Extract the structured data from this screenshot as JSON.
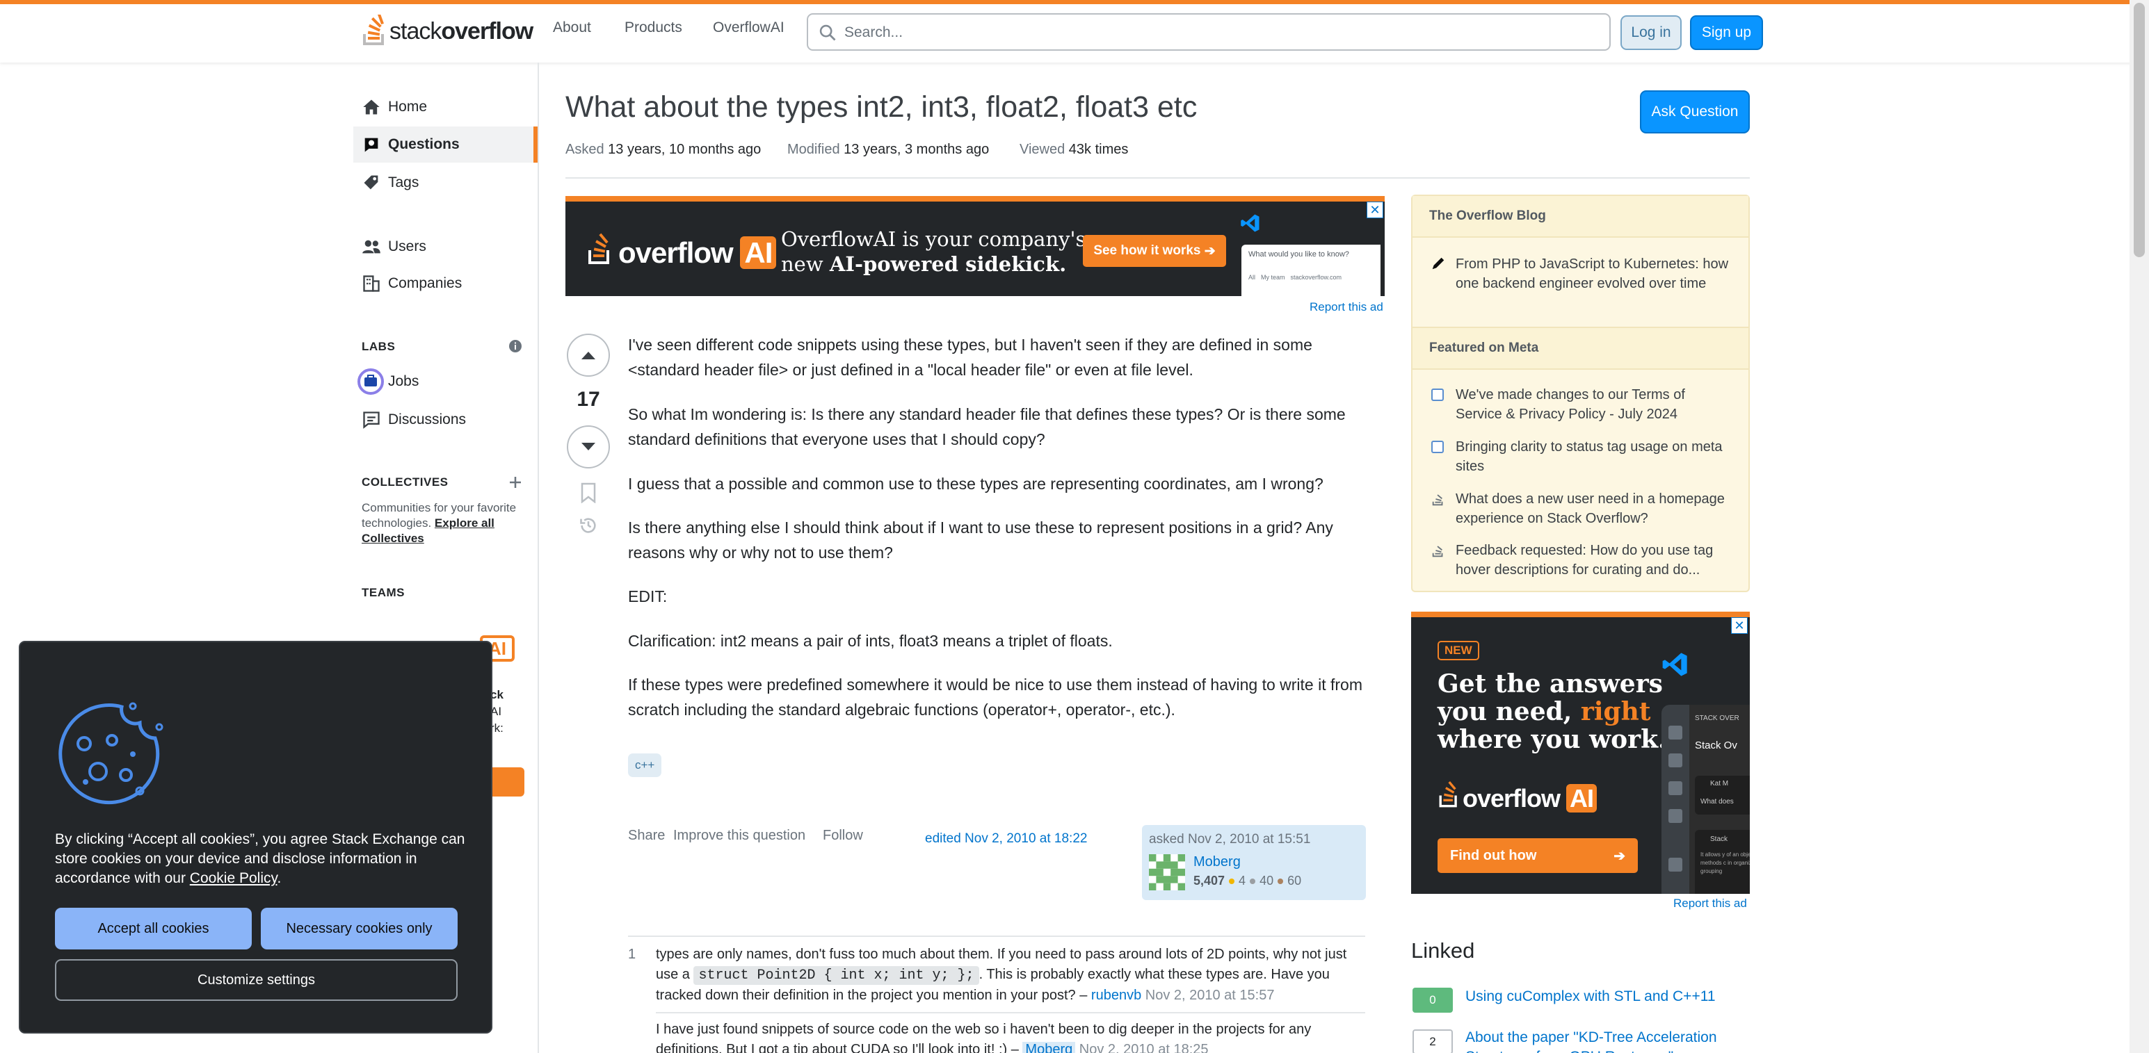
{
  "header": {
    "logo_text_a": "stack",
    "logo_text_b": "overflow",
    "nav": [
      "About",
      "Products",
      "OverflowAI"
    ],
    "search_placeholder": "Search...",
    "login": "Log in",
    "signup": "Sign up"
  },
  "sidebar": {
    "home": "Home",
    "questions": "Questions",
    "tags": "Tags",
    "users": "Users",
    "companies": "Companies",
    "labs_title": "LABS",
    "jobs": "Jobs",
    "discussions": "Discussions",
    "collectives_title": "COLLECTIVES",
    "collectives_text": "Communities for your favorite technologies.",
    "collectives_link": "Explore all Collectives",
    "teams_title": "TEAMS",
    "teams_partial": [
      "ck",
      "AI",
      "rk:"
    ]
  },
  "question": {
    "title": "What about the types int2, int3, float2, float3 etc",
    "asked_label": "Asked",
    "asked_value": "13 years, 10 months ago",
    "modified_label": "Modified",
    "modified_value": "13 years, 3 months ago",
    "viewed_label": "Viewed",
    "viewed_value": "43k times",
    "ask_button": "Ask Question",
    "votes": "17",
    "paragraphs": [
      "I've seen different code snippets using these types, but I haven't seen if they are defined in some <standard header file> or just defined in a \"local header file\" or even at file level.",
      "So what Im wondering is: Is there any standard header file that defines these types? Or is there some standard definitions that everyone uses that I should copy?",
      "I guess that a possible and common use to these types are representing coordinates, am I wrong?",
      "Is there anything else I should think about if I want to use these to represent positions in a grid? Any reasons why or why not to use them?",
      "EDIT:",
      "Clarification: int2 means a pair of ints, float3 means a triplet of floats.",
      "If these types were predefined somewhere it would be nice to use them instead of having to write it from scratch including the standard algebraic functions (operator+, operator-, etc.)."
    ],
    "tag": "c++",
    "share": "Share",
    "improve": "Improve this question",
    "follow": "Follow",
    "edited": "edited Nov 2, 2010 at 18:22",
    "asked_card": "asked Nov 2, 2010 at 15:51",
    "user": "Moberg",
    "rep": "5,407",
    "gold": "4",
    "silver": "40",
    "bronze": "60"
  },
  "ad": {
    "headline_a": "OverflowAI is your company's",
    "headline_b": "new ",
    "headline_bold": "AI-powered sidekick.",
    "cta": "See how it works",
    "brand": "overflow",
    "brand_ai": "AI",
    "mini_text": "What would you like to know?",
    "mini_opts": [
      "All",
      "My team",
      "stackoverflow.com"
    ],
    "report": "Report this ad"
  },
  "comments": [
    {
      "score": "1",
      "text_a": "types are only names, don't fuss too much about them. If you need to pass around lots of 2D points, why not just use a ",
      "code": "struct Point2D { int x; int y; };",
      "text_b": ". This is probably exactly what these types are. Have you tracked down their definition in the project you mention in your post? – ",
      "user": "rubenvb",
      "time": "Nov 2, 2010 at 15:57"
    },
    {
      "score": "",
      "text_a": "I have just found snippets of source code on the web so i haven't been to dig deeper in the projects for any definitions. But I got a tip about CUDA so I'll look into it! :) – ",
      "user": "Moberg",
      "time": "Nov 2, 2010 at 18:25"
    }
  ],
  "blog": {
    "title": "The Overflow Blog",
    "item": "From PHP to JavaScript to Kubernetes: how one backend engineer evolved over time",
    "meta_title": "Featured on Meta",
    "meta_items": [
      "We've made changes to our Terms of Service & Privacy Policy - July 2024",
      "Bringing clarity to status tag usage on meta sites",
      "What does a new user need in a homepage experience on Stack Overflow?",
      "Feedback requested: How do you use tag hover descriptions for curating and do..."
    ]
  },
  "ad2": {
    "badge": "NEW",
    "line1": "Get the answers",
    "line2": "you need, ",
    "line2b": "right",
    "line3": "where you work.",
    "brand": "overflow",
    "brand_ai": "AI",
    "cta": "Find out how",
    "preview_a": "STACK OVER",
    "preview_b": "Stack Ov",
    "preview_c": "Kat M",
    "preview_d": "What does",
    "preview_e": "Stack",
    "preview_f": "It allows y of an obje methods c in organiz grouping",
    "report": "Report this ad"
  },
  "linked": {
    "title": "Linked",
    "items": [
      {
        "count": "0",
        "text": "Using cuComplex with STL and C++11"
      },
      {
        "count": "2",
        "text": "About the paper \"KD-Tree Acceleration Structures for a GPU Raytracer\""
      }
    ]
  },
  "cookie": {
    "text_a": "By clicking “Accept all cookies”, you agree Stack Exchange can store cookies on your device and disclose information in accordance with our ",
    "link": "Cookie Policy",
    "text_b": ".",
    "accept": "Accept all cookies",
    "necessary": "Necessary cookies only",
    "customize": "Customize settings"
  },
  "colors": {
    "accent": "#f48225",
    "blue": "#0a95ff",
    "link": "#0074cc"
  }
}
